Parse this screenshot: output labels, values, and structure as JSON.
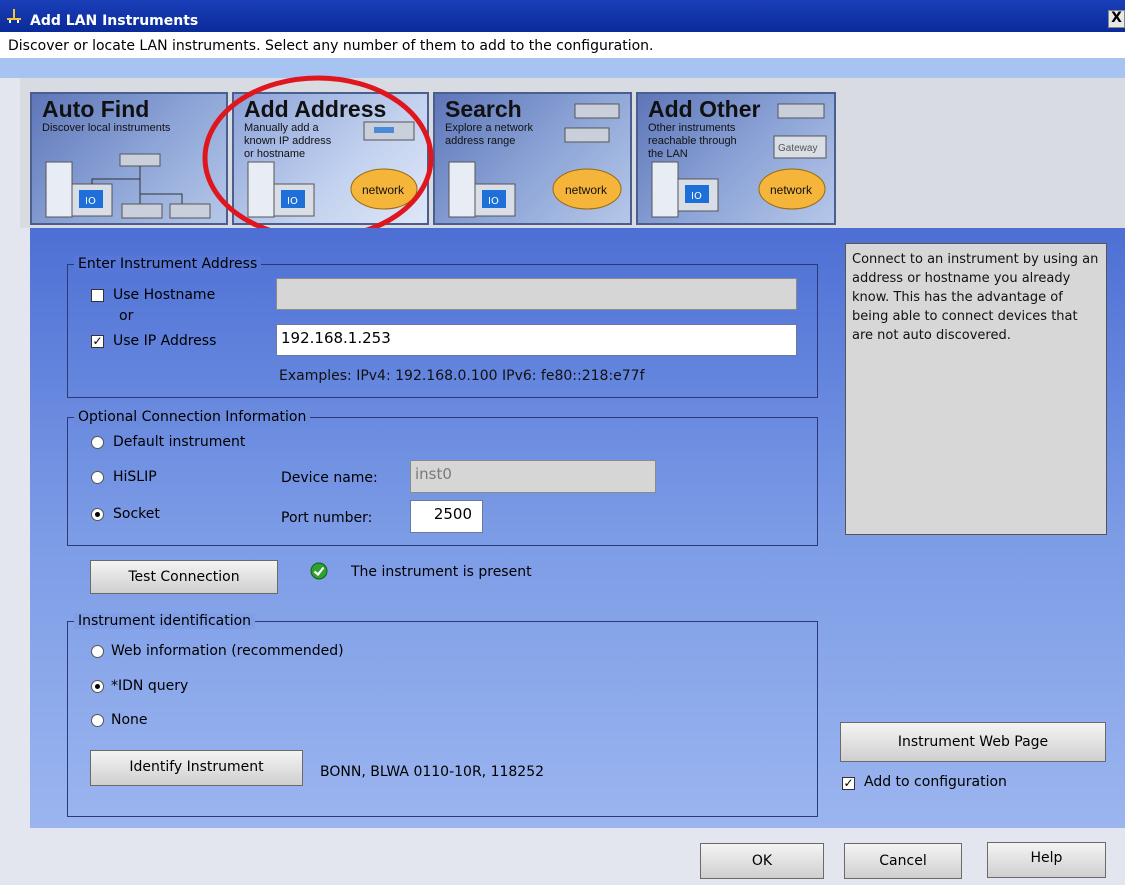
{
  "window": {
    "title": "Add LAN Instruments",
    "subtitle": "Discover or locate LAN instruments. Select any number of them to add to the configuration.",
    "close_glyph": "X"
  },
  "mode_cards": [
    {
      "title": "Auto Find",
      "description": [
        "Discover local instruments"
      ]
    },
    {
      "title": "Add Address",
      "description": [
        "Manually add a",
        "known IP address",
        "or hostname"
      ],
      "label": "network"
    },
    {
      "title": "Search",
      "description": [
        "Explore a network",
        "address range"
      ],
      "label": "network"
    },
    {
      "title": "Add Other",
      "description": [
        "Other instruments",
        "reachable through",
        "the LAN"
      ],
      "label": "network",
      "gateway": "Gateway"
    }
  ],
  "address_group": {
    "title": "Enter Instrument Address",
    "use_hostname_label": "Use Hostname",
    "use_hostname_checked": false,
    "or_label": "or",
    "use_ip_label": "Use IP Address",
    "use_ip_checked": true,
    "hostname_value": "",
    "ip_value": "192.168.1.253",
    "examples": "Examples: IPv4: 192.168.0.100   IPv6: fe80::218:e77f"
  },
  "connection_group": {
    "title": "Optional Connection Information",
    "options": [
      "Default instrument",
      "HiSLIP",
      "Socket"
    ],
    "selected": "Socket",
    "device_name_label": "Device name:",
    "device_name_value": "inst0",
    "port_label": "Port number:",
    "port_value": "2500"
  },
  "test": {
    "button_label": "Test Connection",
    "status_text": "The instrument is present",
    "status_color": "#2fa12f"
  },
  "identification_group": {
    "title": "Instrument identification",
    "options": [
      "Web information (recommended)",
      "*IDN query",
      "None"
    ],
    "selected": "*IDN query",
    "identify_button_label": "Identify Instrument",
    "result": "BONN, BLWA 0110-10R, 118252"
  },
  "info_text": "Connect to an instrument by using an address or hostname you already know. This has the advantage of being able to connect devices that are not auto discovered.",
  "web_page_button_label": "Instrument Web Page",
  "add_to_config_label": "Add to configuration",
  "add_to_config_checked": true,
  "footer": {
    "ok_label": "OK",
    "cancel_label": "Cancel",
    "help_label": "Help"
  },
  "colors": {
    "title_bar": "#0a2a9a",
    "panel": "#6c8ce0",
    "highlight_circle": "#e0161e"
  }
}
